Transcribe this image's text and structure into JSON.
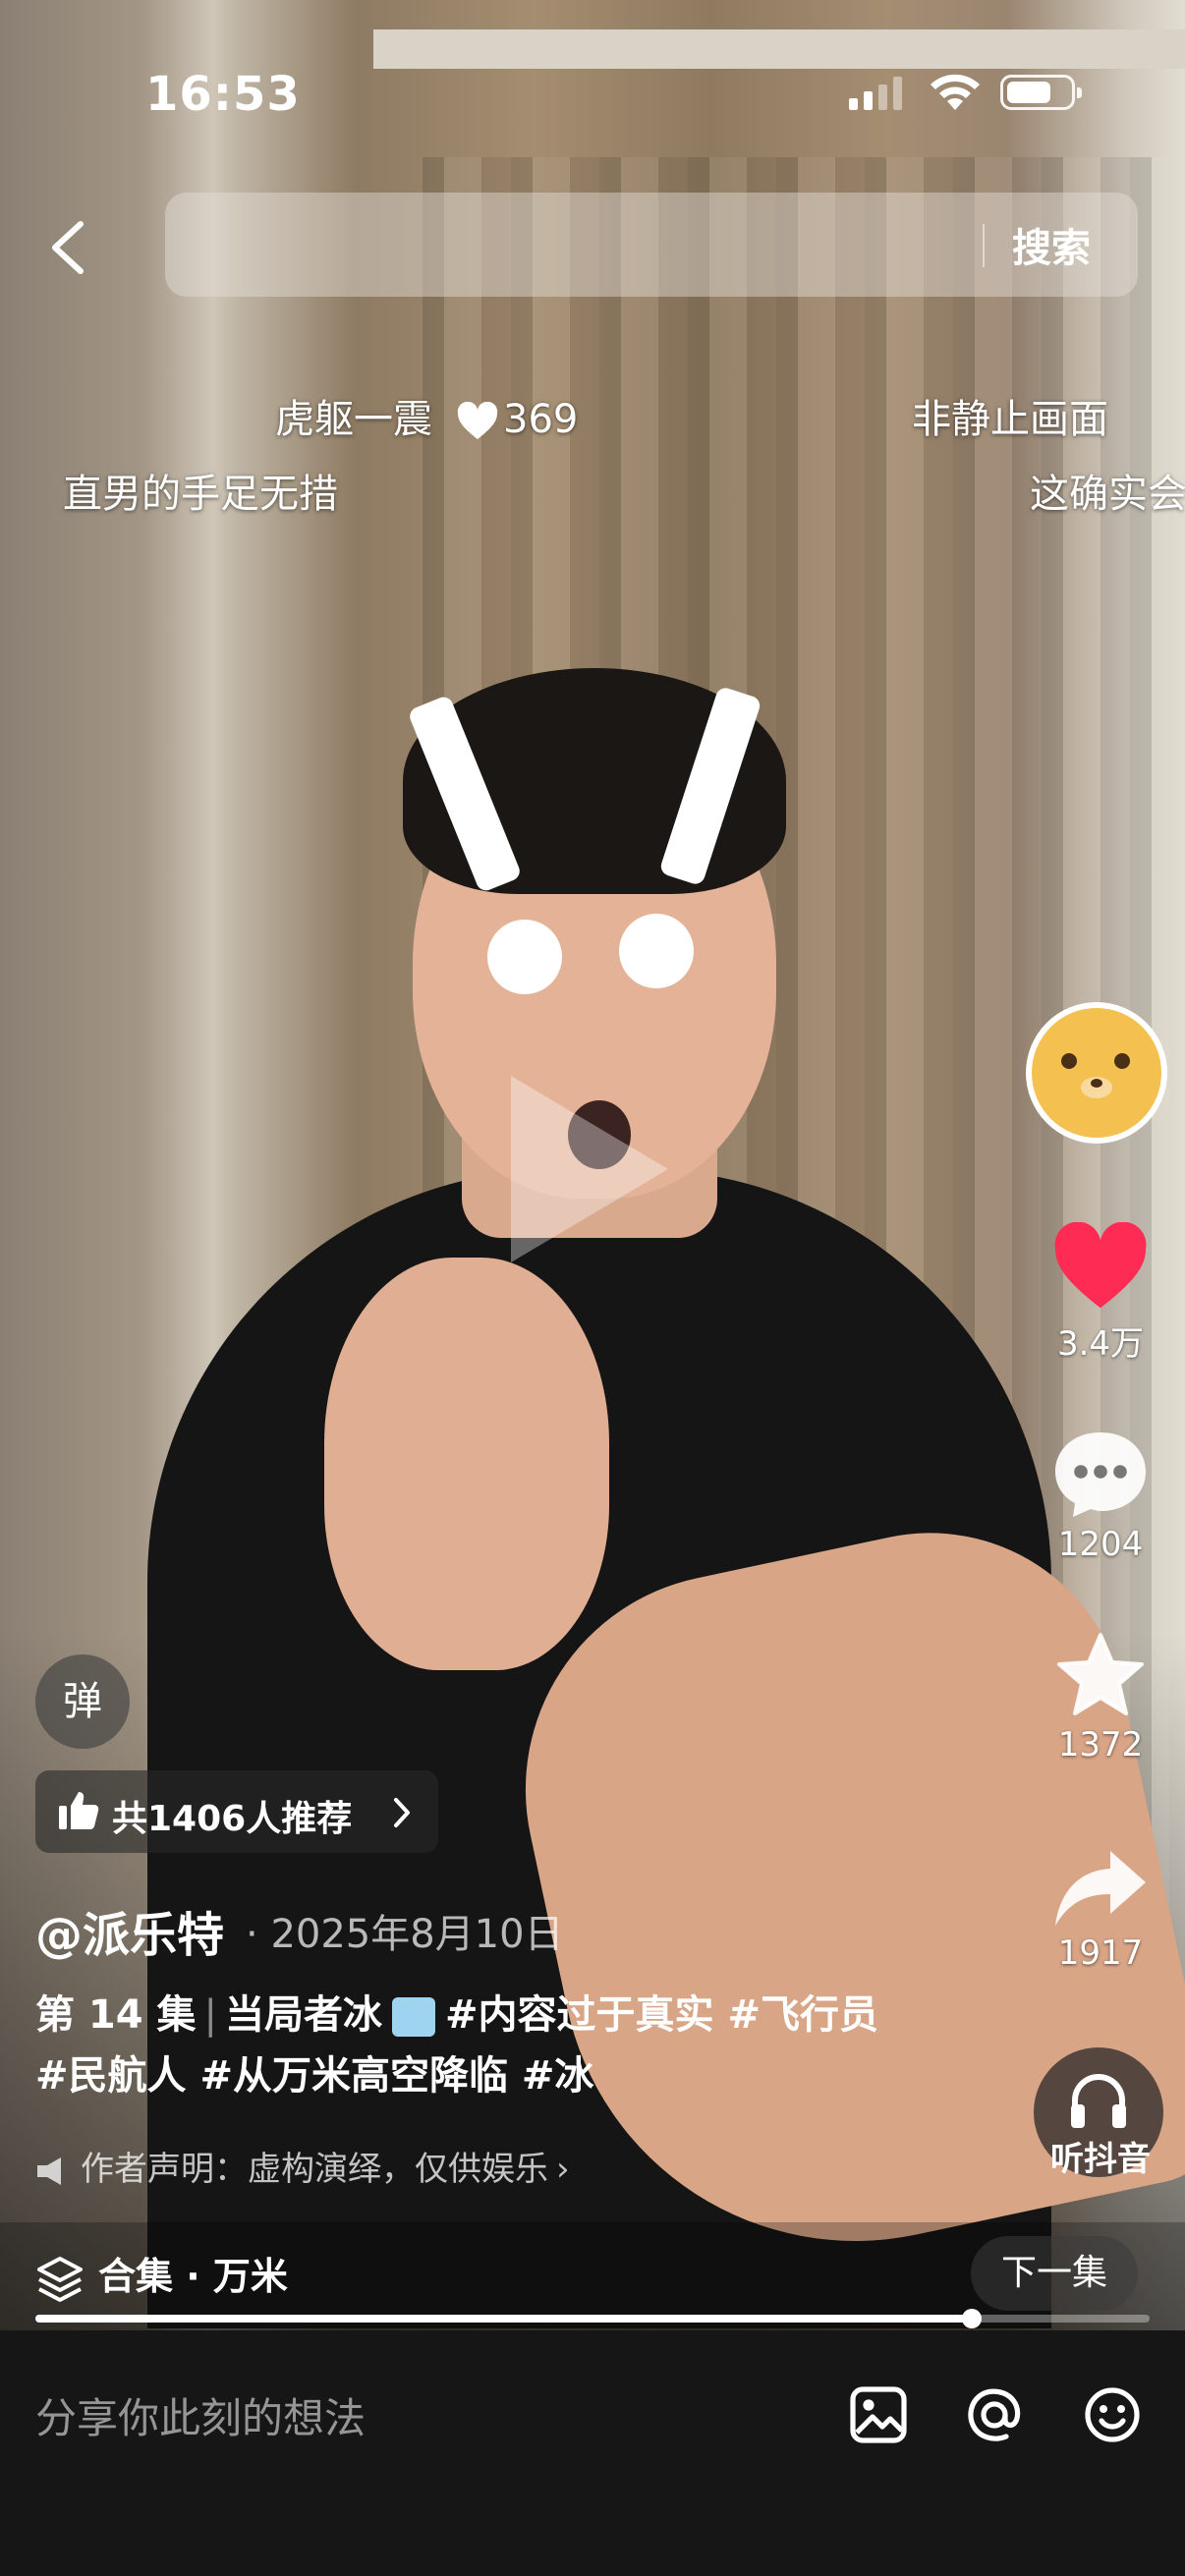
{
  "status_bar": {
    "time": "16:53"
  },
  "top_nav": {
    "search_label": "搜索"
  },
  "danmaku": [
    {
      "text": "虎躯一震",
      "likes": "369"
    },
    {
      "text": "直男的手足无措"
    },
    {
      "text": "非静止画面"
    },
    {
      "text": "这确实会"
    }
  ],
  "right_rail": {
    "likes": "3.4万",
    "comments": "1204",
    "favorites": "1372",
    "shares": "1917",
    "listen_label": "听抖音"
  },
  "overlay": {
    "danmu_toggle": "弹",
    "recommend": "共1406人推荐"
  },
  "post": {
    "author": "@派乐特",
    "date": "2025年8月10日",
    "episode": "第 14 集",
    "title": "当局者冰",
    "hashtags": "#内容过于真实 #飞行员 #民航人 #从万米高空降临 #冰",
    "declaration": "作者声明：虚构演绎，仅供娱乐"
  },
  "collection": {
    "label": "合集 · 万米",
    "next_label": "下一集"
  },
  "progress": {
    "fraction": 0.84
  },
  "comment": {
    "placeholder": "分享你此刻的想法"
  },
  "colors": {
    "like": "#fe2c55",
    "bar_bg": "#161616"
  }
}
